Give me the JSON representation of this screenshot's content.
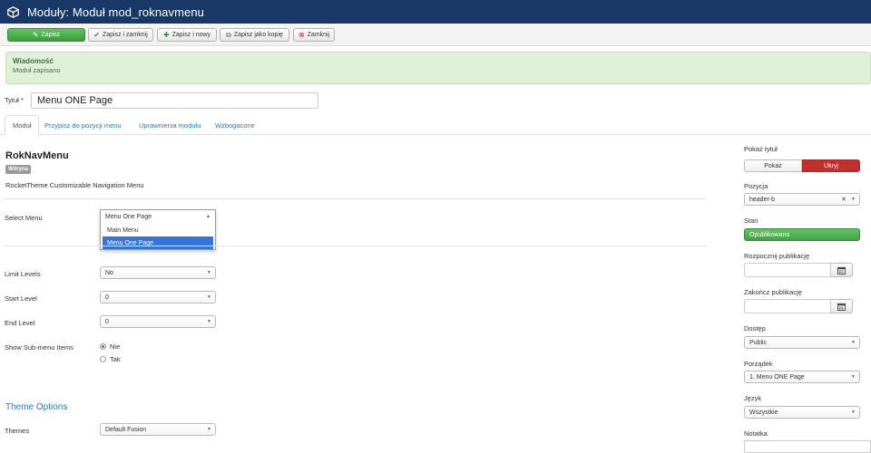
{
  "header": {
    "title": "Moduły: Moduł mod_roknavmenu",
    "icon": "cube-icon"
  },
  "toolbar": {
    "save_label": "Zapisz",
    "save_close_label": "Zapisz i zamknij",
    "save_new_label": "Zapisz i nowy",
    "save_copy_label": "Zapisz jako kopię",
    "close_label": "Zamknij"
  },
  "message": {
    "heading": "Wiadomość",
    "body": "Moduł zapisano"
  },
  "title_field": {
    "label": "Tytuł *",
    "value": "Menu ONE Page"
  },
  "tabs": [
    {
      "label": "Moduł"
    },
    {
      "label": "Przypisz do pozycji menu"
    },
    {
      "label": "Uprawnienia modułu"
    },
    {
      "label": "Wzbogacone"
    }
  ],
  "module": {
    "name": "RokNavMenu",
    "badge": "Witryna",
    "description": "RocketTheme Customizable Navigation Menu"
  },
  "fields": {
    "select_menu": {
      "label": "Select Menu",
      "value": "Menu One Page",
      "options": [
        "Main Menu",
        "Menu One Page"
      ]
    },
    "limit_levels": {
      "label": "Limit Levels",
      "value": "No"
    },
    "start_level": {
      "label": "Start Level",
      "value": "0"
    },
    "end_level": {
      "label": "End Level",
      "value": "0"
    },
    "show_submenu": {
      "label": "Show Sub-menu Items",
      "options": [
        "Nie",
        "Tak"
      ],
      "selected": "Nie"
    }
  },
  "theme_options": {
    "heading": "Theme Options",
    "themes_label": "Themes",
    "themes_value": "Default Fusion"
  },
  "sidebar": {
    "show_title": {
      "label": "Pokaż tytuł",
      "show": "Pokaż",
      "hide": "Ukryj"
    },
    "position": {
      "label": "Pozycja",
      "value": "header-b"
    },
    "status": {
      "label": "Stan",
      "value": "Opublikowano"
    },
    "publish_up": {
      "label": "Rozpocznij publikację"
    },
    "publish_down": {
      "label": "Zakończ publikację"
    },
    "access": {
      "label": "Dostęp",
      "value": "Public"
    },
    "ordering": {
      "label": "Porządek",
      "value": "1. Menu ONE Page"
    },
    "language": {
      "label": "Język",
      "value": "Wszystkie"
    },
    "note": {
      "label": "Notatka"
    }
  },
  "colors": {
    "header": "#1a3867",
    "success": "#46a046",
    "danger": "#c0302c",
    "link": "#2a7bbf"
  }
}
